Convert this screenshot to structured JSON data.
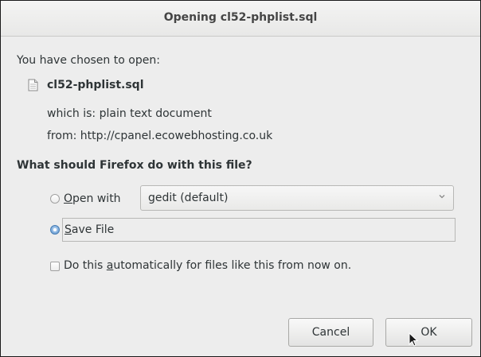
{
  "window": {
    "title": "Opening cl52-phplist.sql"
  },
  "intro": "You have chosen to open:",
  "file": {
    "name": "cl52-phplist.sql",
    "icon": "document-icon",
    "type_line": "which is: plain text document",
    "from_line": "from: http://cpanel.ecowebhosting.co.uk"
  },
  "question": "What should Firefox do with this file?",
  "options": {
    "open_with": {
      "pre": "",
      "mnemonic": "O",
      "post": "pen with",
      "checked": false
    },
    "open_with_app": "gedit (default)",
    "save_file": {
      "mnemonic": "S",
      "post": "ave File",
      "checked": true
    },
    "auto": {
      "pre": "Do this ",
      "mnemonic": "a",
      "post": "utomatically for files like this from now on.",
      "checked": false
    }
  },
  "buttons": {
    "cancel": "Cancel",
    "ok": "OK"
  },
  "colors": {
    "accent": "#4a7fb5",
    "background": "#ededed"
  }
}
